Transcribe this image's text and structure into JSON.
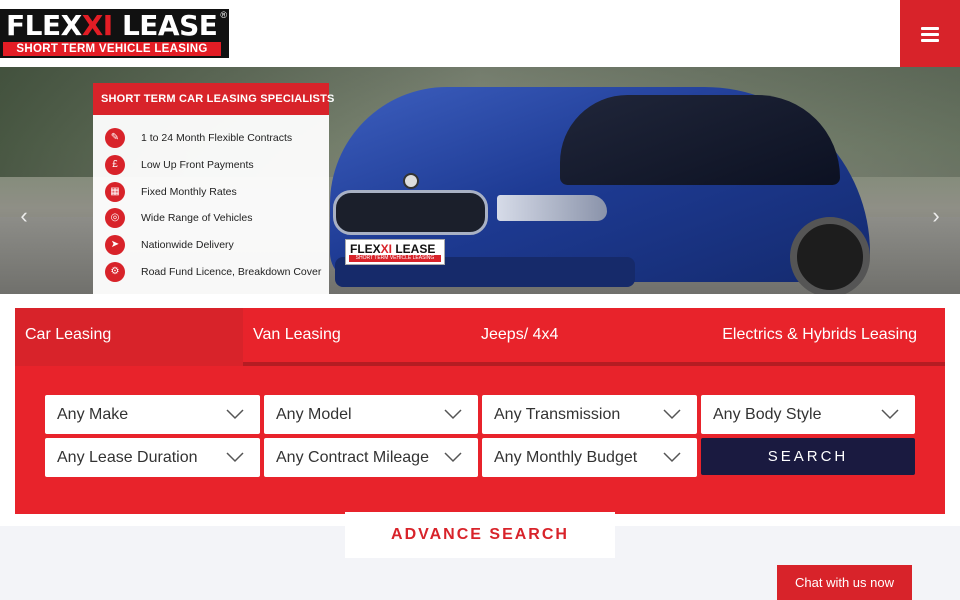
{
  "header": {
    "logo_main_1": "FLEX",
    "logo_main_2": "XI",
    "logo_main_3": " LEASE",
    "logo_reg": "®",
    "logo_sub": "SHORT TERM VEHICLE LEASING",
    "menu_icon": "hamburger-icon"
  },
  "hero": {
    "promo_title": "SHORT TERM CAR LEASING SPECIALISTS",
    "promo_items": [
      "1 to 24 Month Flexible Contracts",
      "Low Up Front Payments",
      "Fixed Monthly Rates",
      "Wide Range of Vehicles",
      "Nationwide Delivery",
      "Road Fund Licence, Breakdown Cover"
    ],
    "plate_main_1": "FLEX",
    "plate_main_2": "XI",
    "plate_main_3": " LEASE",
    "plate_sub": "SHORT TERM VEHICLE LEASING",
    "prev_glyph": "‹",
    "next_glyph": "›"
  },
  "search": {
    "tabs": [
      "Car Leasing",
      "Van Leasing",
      "Jeeps/ 4x4",
      "Electrics & Hybrids Leasing"
    ],
    "active_tab": "Car Leasing",
    "make": "Any Make",
    "model": "Any Model",
    "transmission": "Any Transmission",
    "body_style": "Any Body Style",
    "duration": "Any Lease Duration",
    "mileage": "Any Contract Mileage",
    "budget": "Any Monthly Budget",
    "search_label": "SEARCH",
    "advance_label": "ADVANCE SEARCH"
  },
  "chat": {
    "label": "Chat with us now"
  },
  "colors": {
    "brand_red": "#d8232a",
    "navy": "#1a1a40"
  }
}
